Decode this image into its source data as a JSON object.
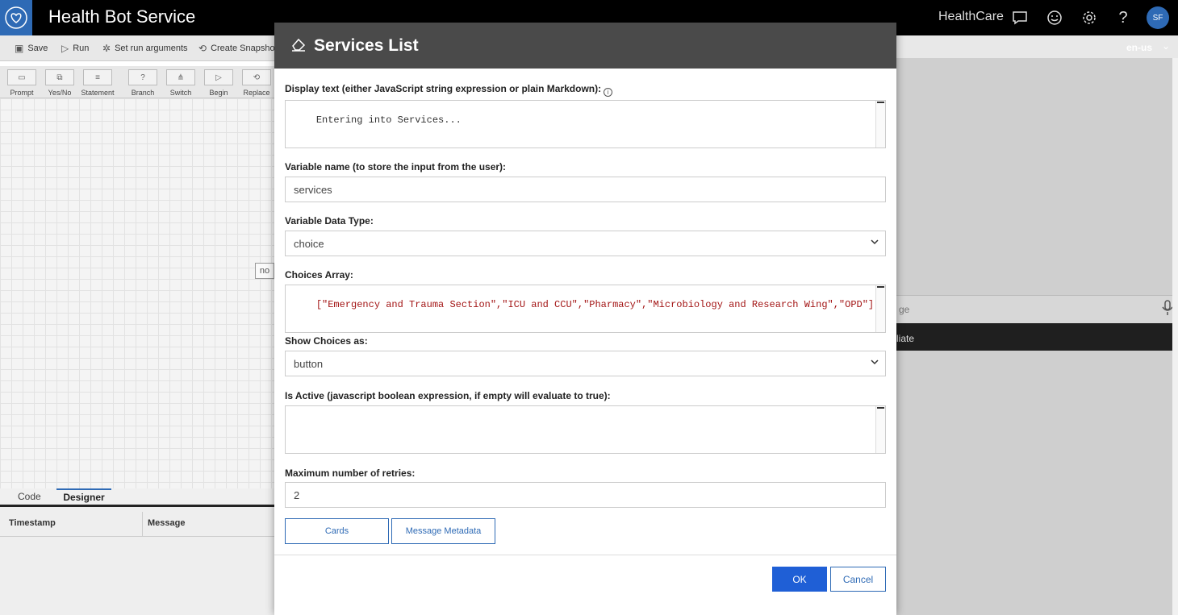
{
  "app": {
    "title": "Health Bot Service",
    "tenant": "HealthCare",
    "avatar_initials": "SF",
    "language": "en-us",
    "icons": [
      "heart-logo-icon",
      "chat-icon",
      "smiley-icon",
      "gear-icon",
      "help-icon"
    ]
  },
  "toolbar": {
    "save": "Save",
    "run": "Run",
    "set_run_arguments": "Set run arguments",
    "create_snapshot": "Create Snapshot"
  },
  "palette": {
    "prompt": "Prompt",
    "yes_no": "Yes/No",
    "statement": "Statement",
    "branch": "Branch",
    "switch": "Switch",
    "begin": "Begin",
    "replace": "Replace"
  },
  "canvas": {
    "node_no": "no"
  },
  "bottom_tabs": {
    "code": "Code",
    "designer": "Designer"
  },
  "log": {
    "col_timestamp": "Timestamp",
    "col_message": "Message"
  },
  "right_panel": {
    "input_partial": "ge",
    "bar_partial": "liate"
  },
  "modal": {
    "title": "Services List",
    "display_text_label": "Display text (either JavaScript string expression or plain Markdown):",
    "display_text_value": "Entering into Services...",
    "variable_name_label": "Variable name (to store the input from the user):",
    "variable_name_value": "services",
    "data_type_label": "Variable Data Type:",
    "data_type_value": "choice",
    "choices_label": "Choices Array:",
    "choices_value": "[\"Emergency and Trauma Section\",\"ICU and CCU\",\"Pharmacy\",\"Microbiology and Research Wing\",\"OPD\"]",
    "show_choices_label": "Show Choices as:",
    "show_choices_value": "button",
    "is_active_label": "Is Active (javascript boolean expression, if empty will evaluate to true):",
    "is_active_value": "",
    "max_retries_label": "Maximum number of retries:",
    "max_retries_value": "2",
    "cards_button": "Cards",
    "metadata_button": "Message Metadata",
    "ok_button": "OK",
    "cancel_button": "Cancel"
  }
}
